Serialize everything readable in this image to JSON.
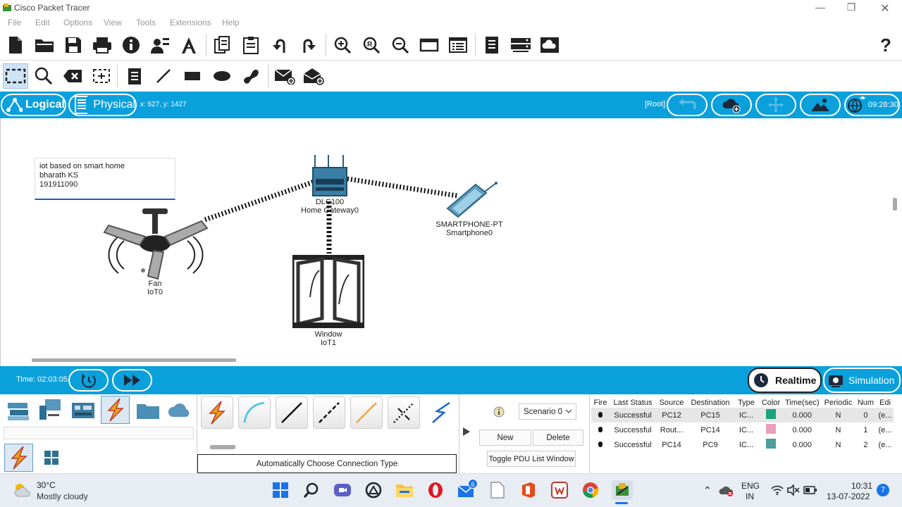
{
  "window": {
    "title": "Cisco Packet Tracer"
  },
  "menu": [
    "File",
    "Edit",
    "Options",
    "View",
    "Tools",
    "Extensions",
    "Help"
  ],
  "help_label": "?",
  "viewbar": {
    "logical": "Logical",
    "physical": "Physical",
    "coords": "x: 627, y: 1427",
    "root": "[Root]",
    "clock": "09:28:30"
  },
  "note": {
    "lines": [
      "iot based on smart home",
      "bharath KS",
      "191911090"
    ]
  },
  "devices": {
    "gateway": {
      "model": "DLC100",
      "name": "Home Gateway0"
    },
    "smartphone": {
      "model": "SMARTPHONE-PT",
      "name": "Smartphone0"
    },
    "fan": {
      "model": "Fan",
      "name": "IoT0"
    },
    "window": {
      "model": "Window",
      "name": "IoT1"
    }
  },
  "timebar": {
    "time": "Time: 02:03:05",
    "realtime": "Realtime",
    "simulation": "Simulation"
  },
  "connections": {
    "caption": "Automatically Choose Connection Type"
  },
  "scenario": {
    "selected": "Scenario 0",
    "new_label": "New",
    "delete_label": "Delete",
    "toggle_label": "Toggle PDU List Window"
  },
  "pdu_table": {
    "headers": [
      "Fire",
      "Last Status",
      "Source",
      "Destination",
      "Type",
      "Color",
      "Time(sec)",
      "Periodic",
      "Num",
      "Edi"
    ],
    "rows": [
      {
        "status": "Successful",
        "source": "PC12",
        "dest": "PC15",
        "type": "IC...",
        "color": "#1aa37a",
        "time": "0.000",
        "periodic": "N",
        "num": "0",
        "edit": "(e..."
      },
      {
        "status": "Successful",
        "source": "Rout...",
        "dest": "PC14",
        "type": "IC...",
        "color": "#e8a0bc",
        "time": "0.000",
        "periodic": "N",
        "num": "1",
        "edit": "(e..."
      },
      {
        "status": "Successful",
        "source": "PC14",
        "dest": "PC9",
        "type": "IC...",
        "color": "#4a9e9c",
        "time": "0.000",
        "periodic": "N",
        "num": "2",
        "edit": "(e..."
      }
    ]
  },
  "taskbar": {
    "weather_temp": "30°C",
    "weather_desc": "Mostly cloudy",
    "lang": "ENG",
    "region": "IN",
    "time": "10:31",
    "date": "13-07-2022",
    "mail_badge": "6",
    "notif_count": "7"
  },
  "colors": {
    "accent": "#0aa0dc"
  }
}
